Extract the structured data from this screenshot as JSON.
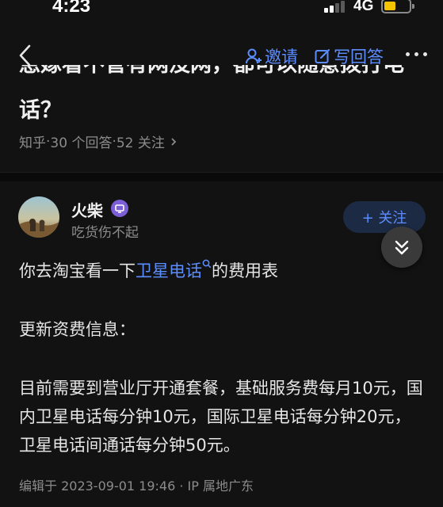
{
  "status_bar": {
    "time": "4:23",
    "network": "4G",
    "battery_level": 0.4,
    "battery_color": "#f5c400"
  },
  "nav": {
    "back_icon": "chevron-left-icon",
    "invite_label": "邀请",
    "write_label": "写回答",
    "more_icon": "more-horizontal-icon",
    "accent": "#5c8dff"
  },
  "question": {
    "title_line1": "急嫁看不管有网没网，都可以随意拨打电",
    "title_line2": "话？",
    "source": "知乎",
    "answers": "30 个回答",
    "followers": "52 关注",
    "dot": " · "
  },
  "author": {
    "name": "火柴",
    "bio": "吃货伤不起",
    "follow_label": "+ 关注"
  },
  "answer": {
    "p1_before": "你去淘宝看一下",
    "p1_link": "卫星电话",
    "p1_after": "的费用表",
    "p2": "更新资费信息：",
    "p3": "目前需要到营业厅开通套餐，基础服务费每月10元，国内卫星电话每分钟10元，国际卫星电话每分钟20元，卫星电话间通话每分钟50元。",
    "edit_meta": "编辑于 2023-09-01 19:46 · IP 属地广东"
  }
}
